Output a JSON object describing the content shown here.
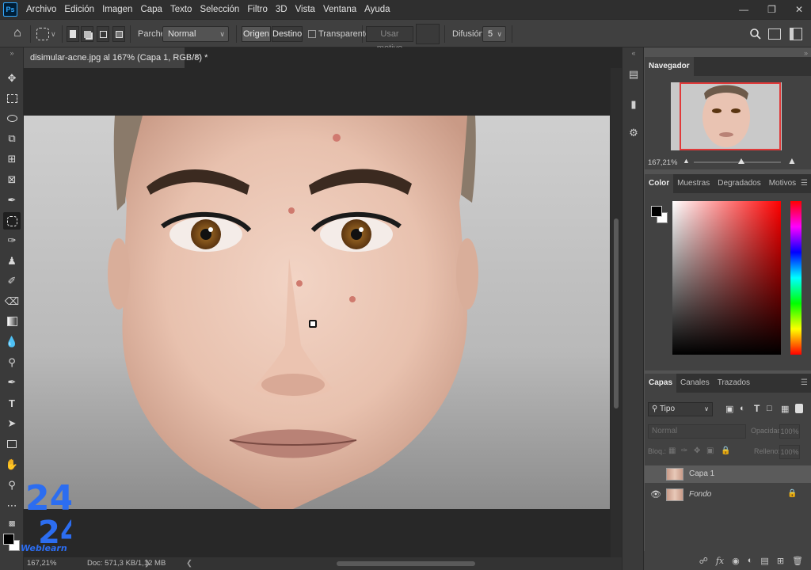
{
  "app": {
    "logo_text": "Ps"
  },
  "menu": [
    "Archivo",
    "Edición",
    "Imagen",
    "Capa",
    "Texto",
    "Selección",
    "Filtro",
    "3D",
    "Vista",
    "Ventana",
    "Ayuda"
  ],
  "window_controls": {
    "minimize": "—",
    "restore": "❐",
    "close": "✕"
  },
  "options": {
    "patch_label": "Parche:",
    "patch_mode": "Normal",
    "source": "Origen",
    "destination": "Destino",
    "transparent": "Transparente",
    "use_pattern": "Usar motivo",
    "diffusion_label": "Difusión:",
    "diffusion_value": "5"
  },
  "document": {
    "tab_title": "disimular-acne.jpg al 167% (Capa 1, RGB/8) *",
    "zoom": "167,21%",
    "doc_info": "Doc: 571,3 KB/1,12 MB"
  },
  "navigator": {
    "title": "Navegador",
    "zoom": "167,21%"
  },
  "color_panel": {
    "tabs": [
      "Color",
      "Muestras",
      "Degradados",
      "Motivos"
    ],
    "foreground": "#000000",
    "background": "#ffffff"
  },
  "layers_panel": {
    "tabs": [
      "Capas",
      "Canales",
      "Trazados"
    ],
    "filter_label": "Tipo",
    "blend_mode": "Normal",
    "opacity_label": "Opacidad:",
    "opacity": "100%",
    "lock_label": "Bloq.:",
    "fill_label": "Relleno:",
    "fill": "100%",
    "layers": [
      {
        "name": "Capa 1",
        "visible": false,
        "selected": true,
        "locked": false
      },
      {
        "name": "Fondo",
        "visible": true,
        "selected": false,
        "locked": true
      }
    ]
  },
  "watermark": {
    "digits": "24",
    "text": "Weblearn"
  },
  "colors": {
    "accent_blue": "#31a8ff",
    "nav_frame": "#e03a3a",
    "watermark_blue": "#2c6df0"
  }
}
